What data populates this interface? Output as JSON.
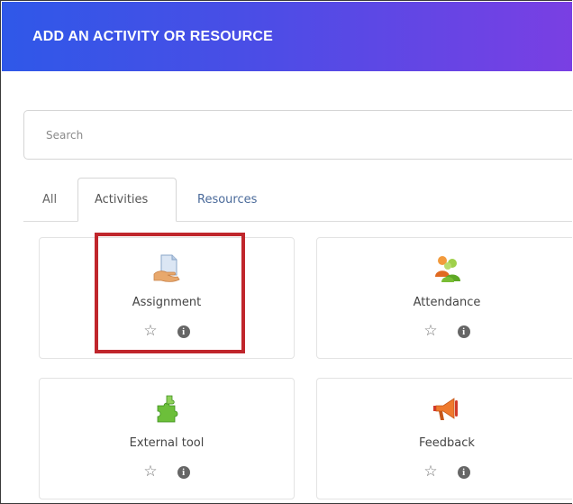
{
  "modal": {
    "title": "ADD AN ACTIVITY OR RESOURCE"
  },
  "search": {
    "placeholder": "Search",
    "value": ""
  },
  "tabs": [
    {
      "label": "All",
      "active": false
    },
    {
      "label": "Activities",
      "active": true
    },
    {
      "label": "Resources",
      "active": false
    }
  ],
  "modules": [
    {
      "label": "Assignment",
      "icon": "assignment-icon",
      "highlighted": true
    },
    {
      "label": "Attendance",
      "icon": "attendance-icon",
      "highlighted": false
    },
    {
      "label": "External tool",
      "icon": "external-tool-icon",
      "highlighted": false
    },
    {
      "label": "Feedback",
      "icon": "feedback-icon",
      "highlighted": false
    }
  ],
  "colors": {
    "header_start": "#2f58e8",
    "header_end": "#7a3fe3",
    "highlight_border": "#c0262c",
    "tab_link": "#4a6a9a"
  },
  "icons": {
    "star": "☆",
    "info": "i"
  }
}
